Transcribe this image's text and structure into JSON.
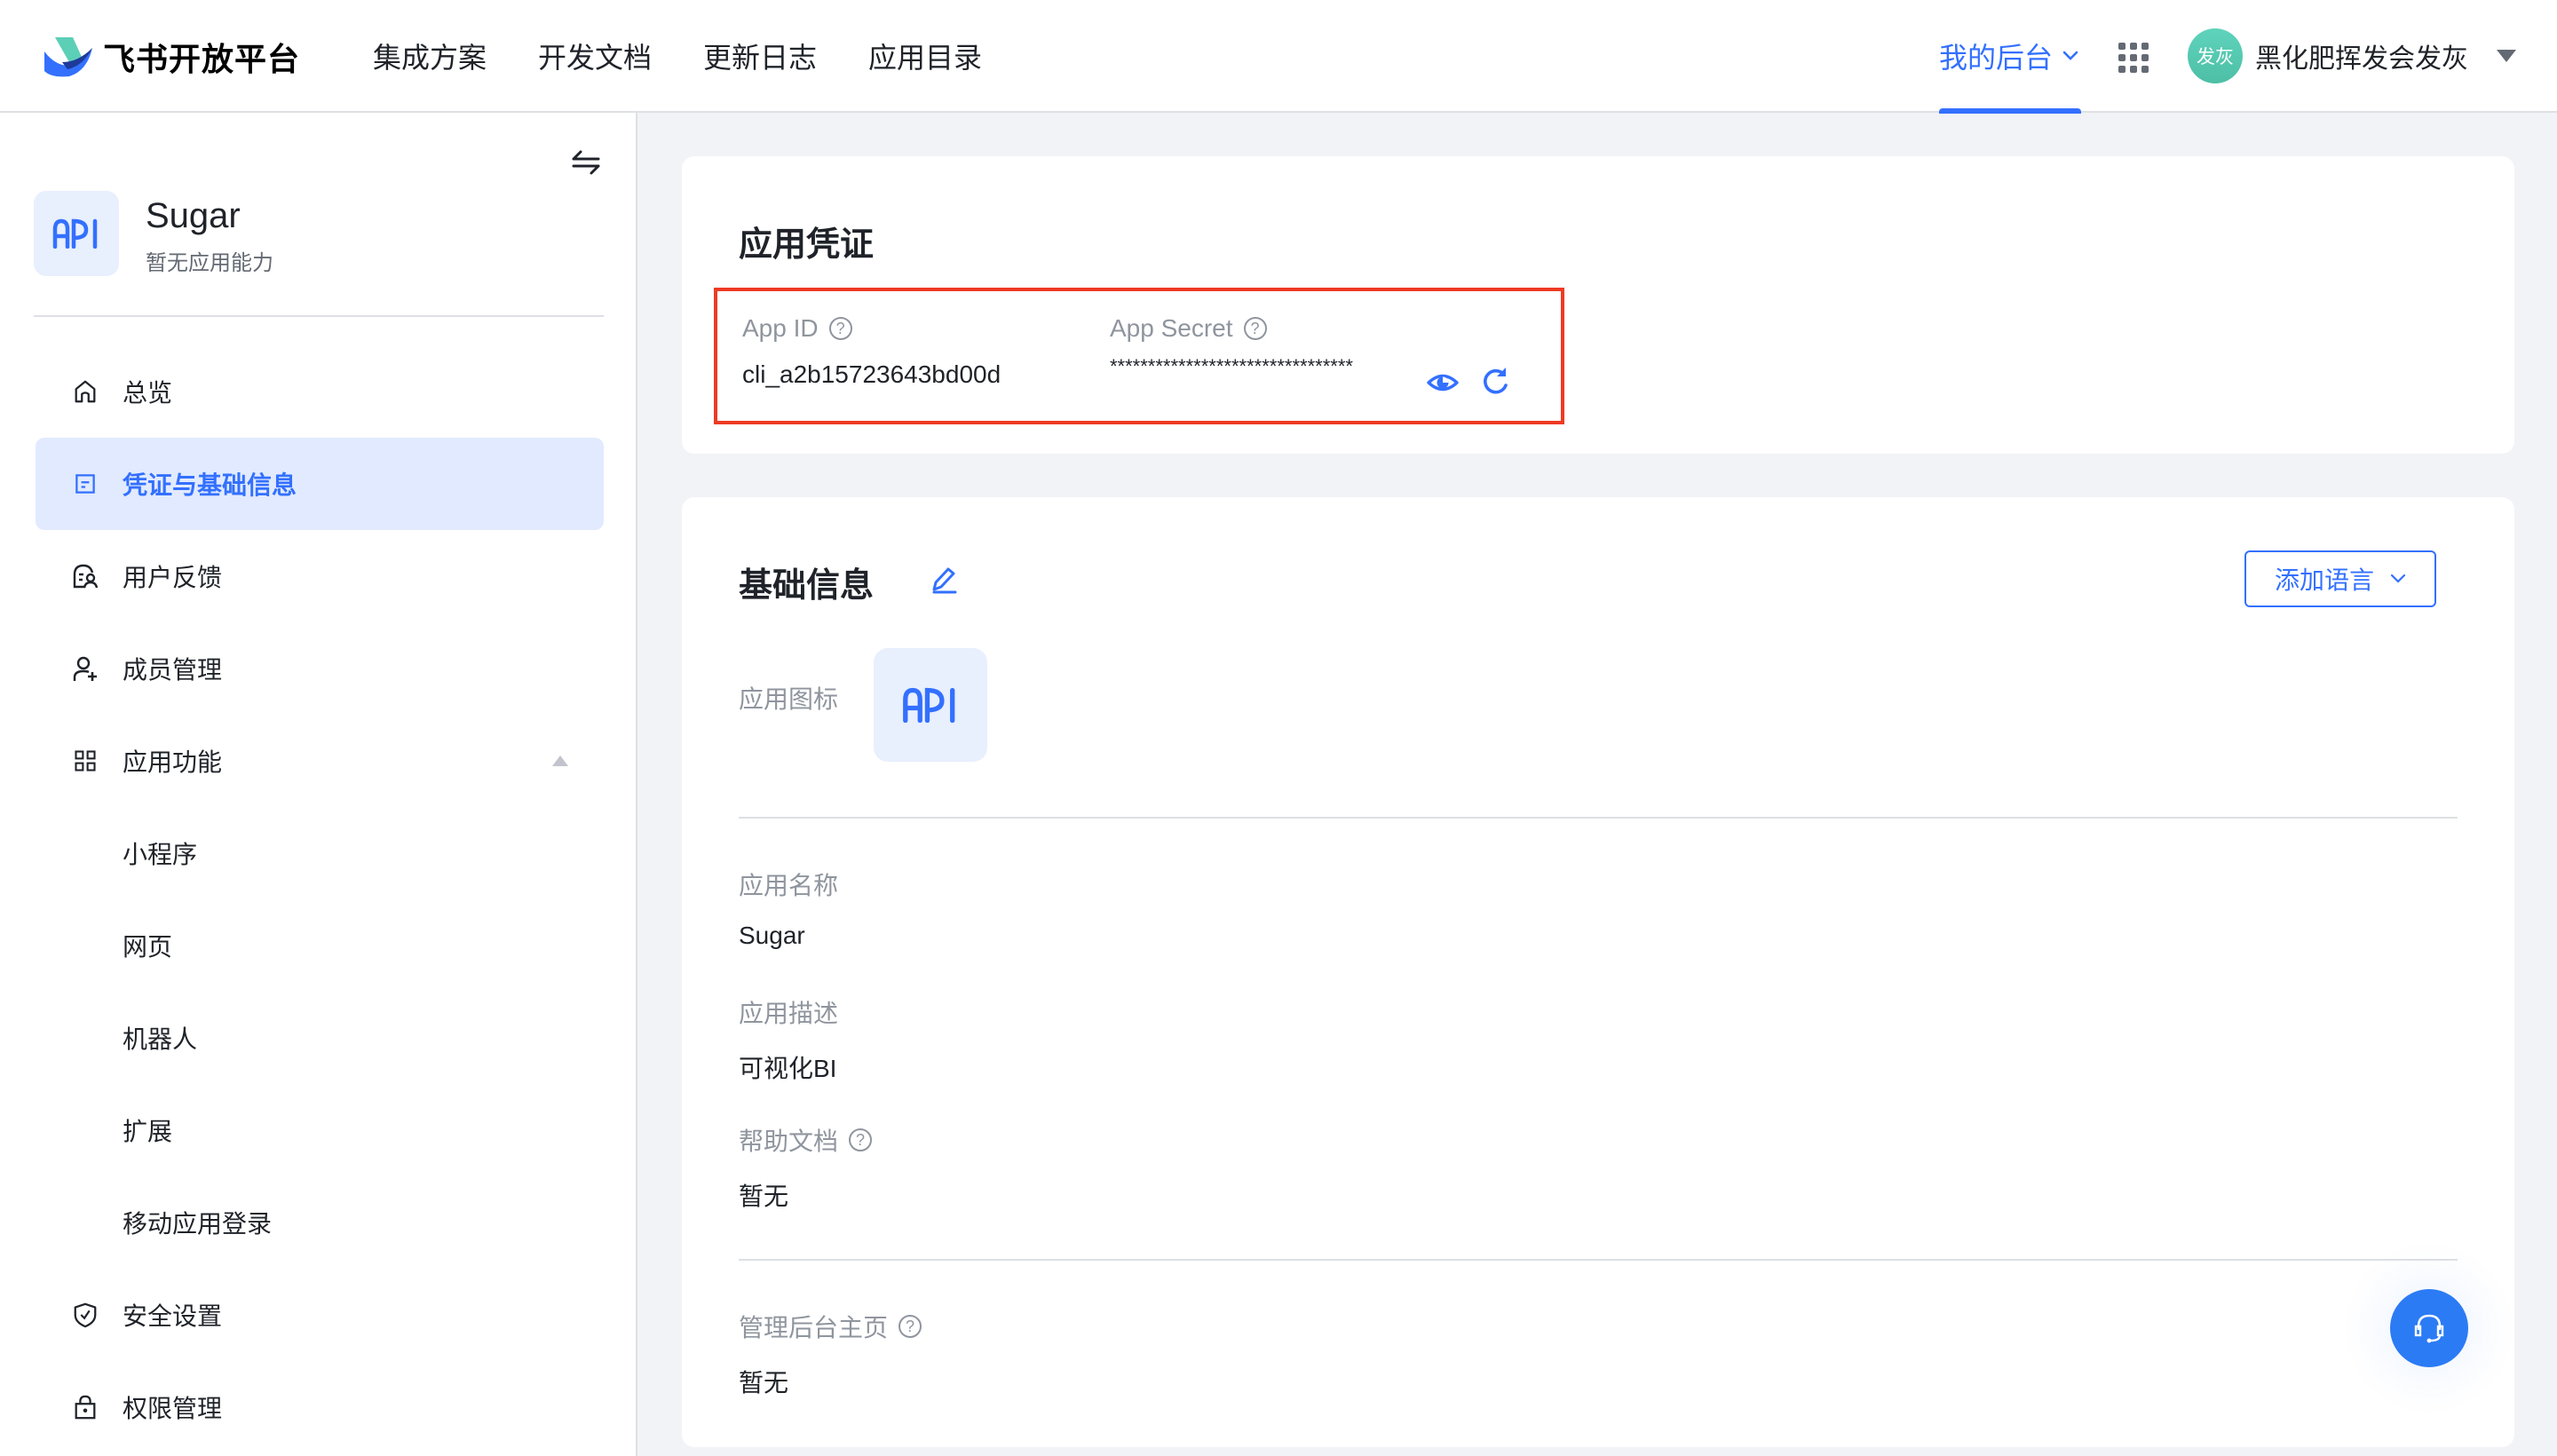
{
  "header": {
    "brand": "飞书开放平台",
    "nav": [
      {
        "label": "集成方案"
      },
      {
        "label": "开发文档"
      },
      {
        "label": "更新日志"
      },
      {
        "label": "应用目录"
      }
    ],
    "console_tab": "我的后台",
    "user": {
      "avatar_text": "发灰",
      "name": "黑化肥挥发会发灰"
    }
  },
  "sidebar": {
    "app": {
      "name": "Sugar",
      "subtitle": "暂无应用能力",
      "icon_text": "API"
    },
    "menu": [
      {
        "label": "总览",
        "icon": "home-icon"
      },
      {
        "label": "凭证与基础信息",
        "icon": "credential-icon",
        "active": true
      },
      {
        "label": "用户反馈",
        "icon": "feedback-icon"
      },
      {
        "label": "成员管理",
        "icon": "add-member-icon"
      },
      {
        "label": "应用功能",
        "icon": "grid-icon",
        "expanded": true
      },
      {
        "label": "小程序",
        "sub": true
      },
      {
        "label": "网页",
        "sub": true
      },
      {
        "label": "机器人",
        "sub": true
      },
      {
        "label": "扩展",
        "sub": true
      },
      {
        "label": "移动应用登录",
        "sub": true
      },
      {
        "label": "安全设置",
        "icon": "shield-icon"
      },
      {
        "label": "权限管理",
        "icon": "lock-icon"
      }
    ]
  },
  "credentials": {
    "title": "应用凭证",
    "app_id_label": "App ID",
    "app_id_value": "cli_a2b15723643bd00d",
    "app_secret_label": "App Secret",
    "app_secret_value": "********************************",
    "highlight_color": "#ee3a24"
  },
  "basic_info": {
    "title": "基础信息",
    "add_language_label": "添加语言",
    "icon_label": "应用图标",
    "icon_text": "API",
    "fields": [
      {
        "label": "应用名称",
        "value": "Sugar",
        "help": false
      },
      {
        "label": "应用描述",
        "value": "可视化BI",
        "help": false
      },
      {
        "label": "帮助文档",
        "value": "暂无",
        "help": true
      },
      {
        "label": "管理后台主页",
        "value": "暂无",
        "help": true
      }
    ]
  },
  "colors": {
    "accent": "#3370ff",
    "active_bg": "#e1eaff",
    "page_bg": "#f2f3f7",
    "fab": "#2b7bf5"
  }
}
